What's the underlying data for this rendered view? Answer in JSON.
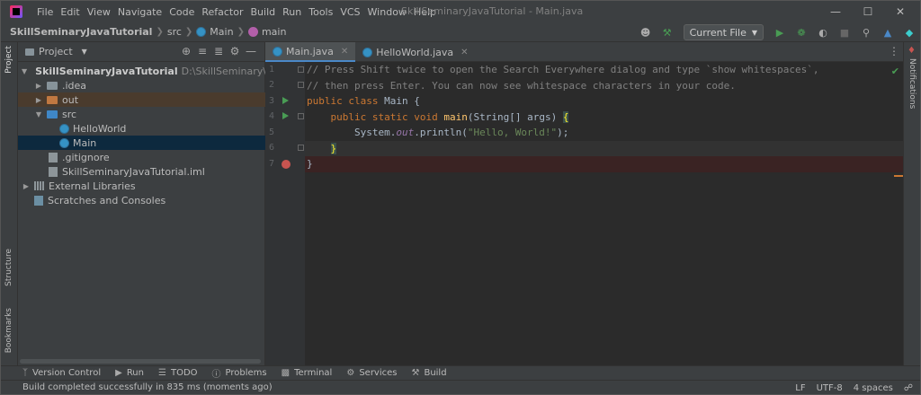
{
  "titlebar": {
    "menu": [
      "File",
      "Edit",
      "View",
      "Navigate",
      "Code",
      "Refactor",
      "Build",
      "Run",
      "Tools",
      "VCS",
      "Window",
      "Help"
    ],
    "title": "SkillSeminaryJavaTutorial - Main.java"
  },
  "breadcrumb": {
    "project": "SkillSeminaryJavaTutorial",
    "folder": "src",
    "class": "Main",
    "method": "main"
  },
  "toolbar": {
    "run_config": "Current File"
  },
  "left_stripe": {
    "project": "Project",
    "structure": "Structure",
    "bookmarks": "Bookmarks"
  },
  "right_stripe": {
    "notifications": "Notifications"
  },
  "project_panel": {
    "title": "Project",
    "root_name": "SkillSeminaryJavaTutorial",
    "root_path": "D:\\SkillSeminary\\Java\\SkillSe",
    "items": {
      "idea": ".idea",
      "out": "out",
      "src": "src",
      "helloworld": "HelloWorld",
      "main": "Main",
      "gitignore": ".gitignore",
      "iml": "SkillSeminaryJavaTutorial.iml",
      "external_libraries": "External Libraries",
      "scratches": "Scratches and Consoles"
    }
  },
  "editor": {
    "tabs": [
      "Main.java",
      "HelloWorld.java"
    ],
    "line_numbers": [
      "1",
      "2",
      "3",
      "4",
      "5",
      "6",
      "7"
    ],
    "code": {
      "l1": "// Press Shift twice to open the Search Everywhere dialog and type `show whitespaces`,",
      "l2": "// then press Enter. You can now see whitespace characters in your code.",
      "l3_kw1": "public",
      "l3_kw2": "class",
      "l3_name": "Main {",
      "l4_kw1": "public",
      "l4_kw2": "static",
      "l4_kw3": "void",
      "l4_fn": "main",
      "l4_args": "(String[] args) ",
      "l4_brace": "{",
      "l5_sys": "System.",
      "l5_out": "out",
      "l5_println": ".println(",
      "l5_str": "\"Hello, World!\"",
      "l5_end": ");",
      "l6": "}",
      "l7": "}"
    }
  },
  "bottom_tools": [
    "Version Control",
    "Run",
    "TODO",
    "Problems",
    "Terminal",
    "Services",
    "Build"
  ],
  "status": {
    "message": "Build completed successfully in 835 ms (moments ago)",
    "line_sep": "LF",
    "encoding": "UTF-8",
    "indent": "4 spaces"
  }
}
